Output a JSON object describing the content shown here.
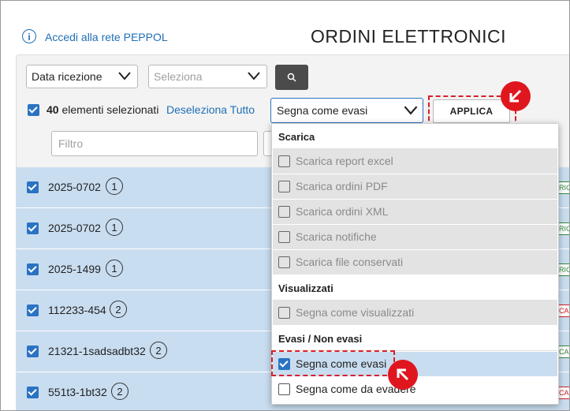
{
  "header": {
    "info_icon": "i",
    "peppol_link": "Accedi alla rete PEPPOL",
    "title": "ORDINI ELETTRONICI"
  },
  "filters": {
    "date_select": "Data ricezione",
    "secondary_select_placeholder": "Seleziona",
    "filter_placeholder": "Filtro"
  },
  "selection": {
    "count": "40",
    "count_label": " elementi selezionati",
    "deselect_link": "Deseleziona Tutto"
  },
  "actions": {
    "action_select": "Segna come evasi",
    "apply_button": "APPLICA"
  },
  "menu": {
    "groups": [
      {
        "header": "Scarica",
        "items": [
          {
            "label": "Scarica report excel",
            "checked": false,
            "disabled": true
          },
          {
            "label": "Scarica ordini PDF",
            "checked": false,
            "disabled": true
          },
          {
            "label": "Scarica ordini XML",
            "checked": false,
            "disabled": true
          },
          {
            "label": "Scarica notifiche",
            "checked": false,
            "disabled": true
          },
          {
            "label": "Scarica file conservati",
            "checked": false,
            "disabled": true
          }
        ]
      },
      {
        "header": "Visualizzati",
        "items": [
          {
            "label": "Segna come visualizzati",
            "checked": false,
            "disabled": true
          }
        ]
      },
      {
        "header": "Evasi / Non evasi",
        "items": [
          {
            "label": "Segna come evasi",
            "checked": true,
            "disabled": false
          },
          {
            "label": "Segna come da evadere",
            "checked": false,
            "disabled": false
          }
        ]
      }
    ]
  },
  "rows": [
    {
      "code": "2025-0702",
      "count": "1",
      "status": "RICE",
      "status_color": "#2e8b3e"
    },
    {
      "code": "2025-0702",
      "count": "1",
      "status": "RICE",
      "status_color": "#2e8b3e"
    },
    {
      "code": "2025-1499",
      "count": "1",
      "status": "RICE",
      "status_color": "#2e8b3e"
    },
    {
      "code": "112233-454",
      "count": "2",
      "status": "CA O",
      "status_color": "#d81f26"
    },
    {
      "code": "21321-1sadsadbt32",
      "count": "2",
      "status": "CA O",
      "status_color": "#2e8b3e"
    },
    {
      "code": "551t3-1bt32",
      "count": "2",
      "status": "CA S",
      "status_color": "#d81f26"
    }
  ],
  "colors": {
    "accent": "#2b73c2",
    "link": "#1f6fb5",
    "highlight": "#d81f26",
    "row_selected": "#c9ddf0"
  }
}
